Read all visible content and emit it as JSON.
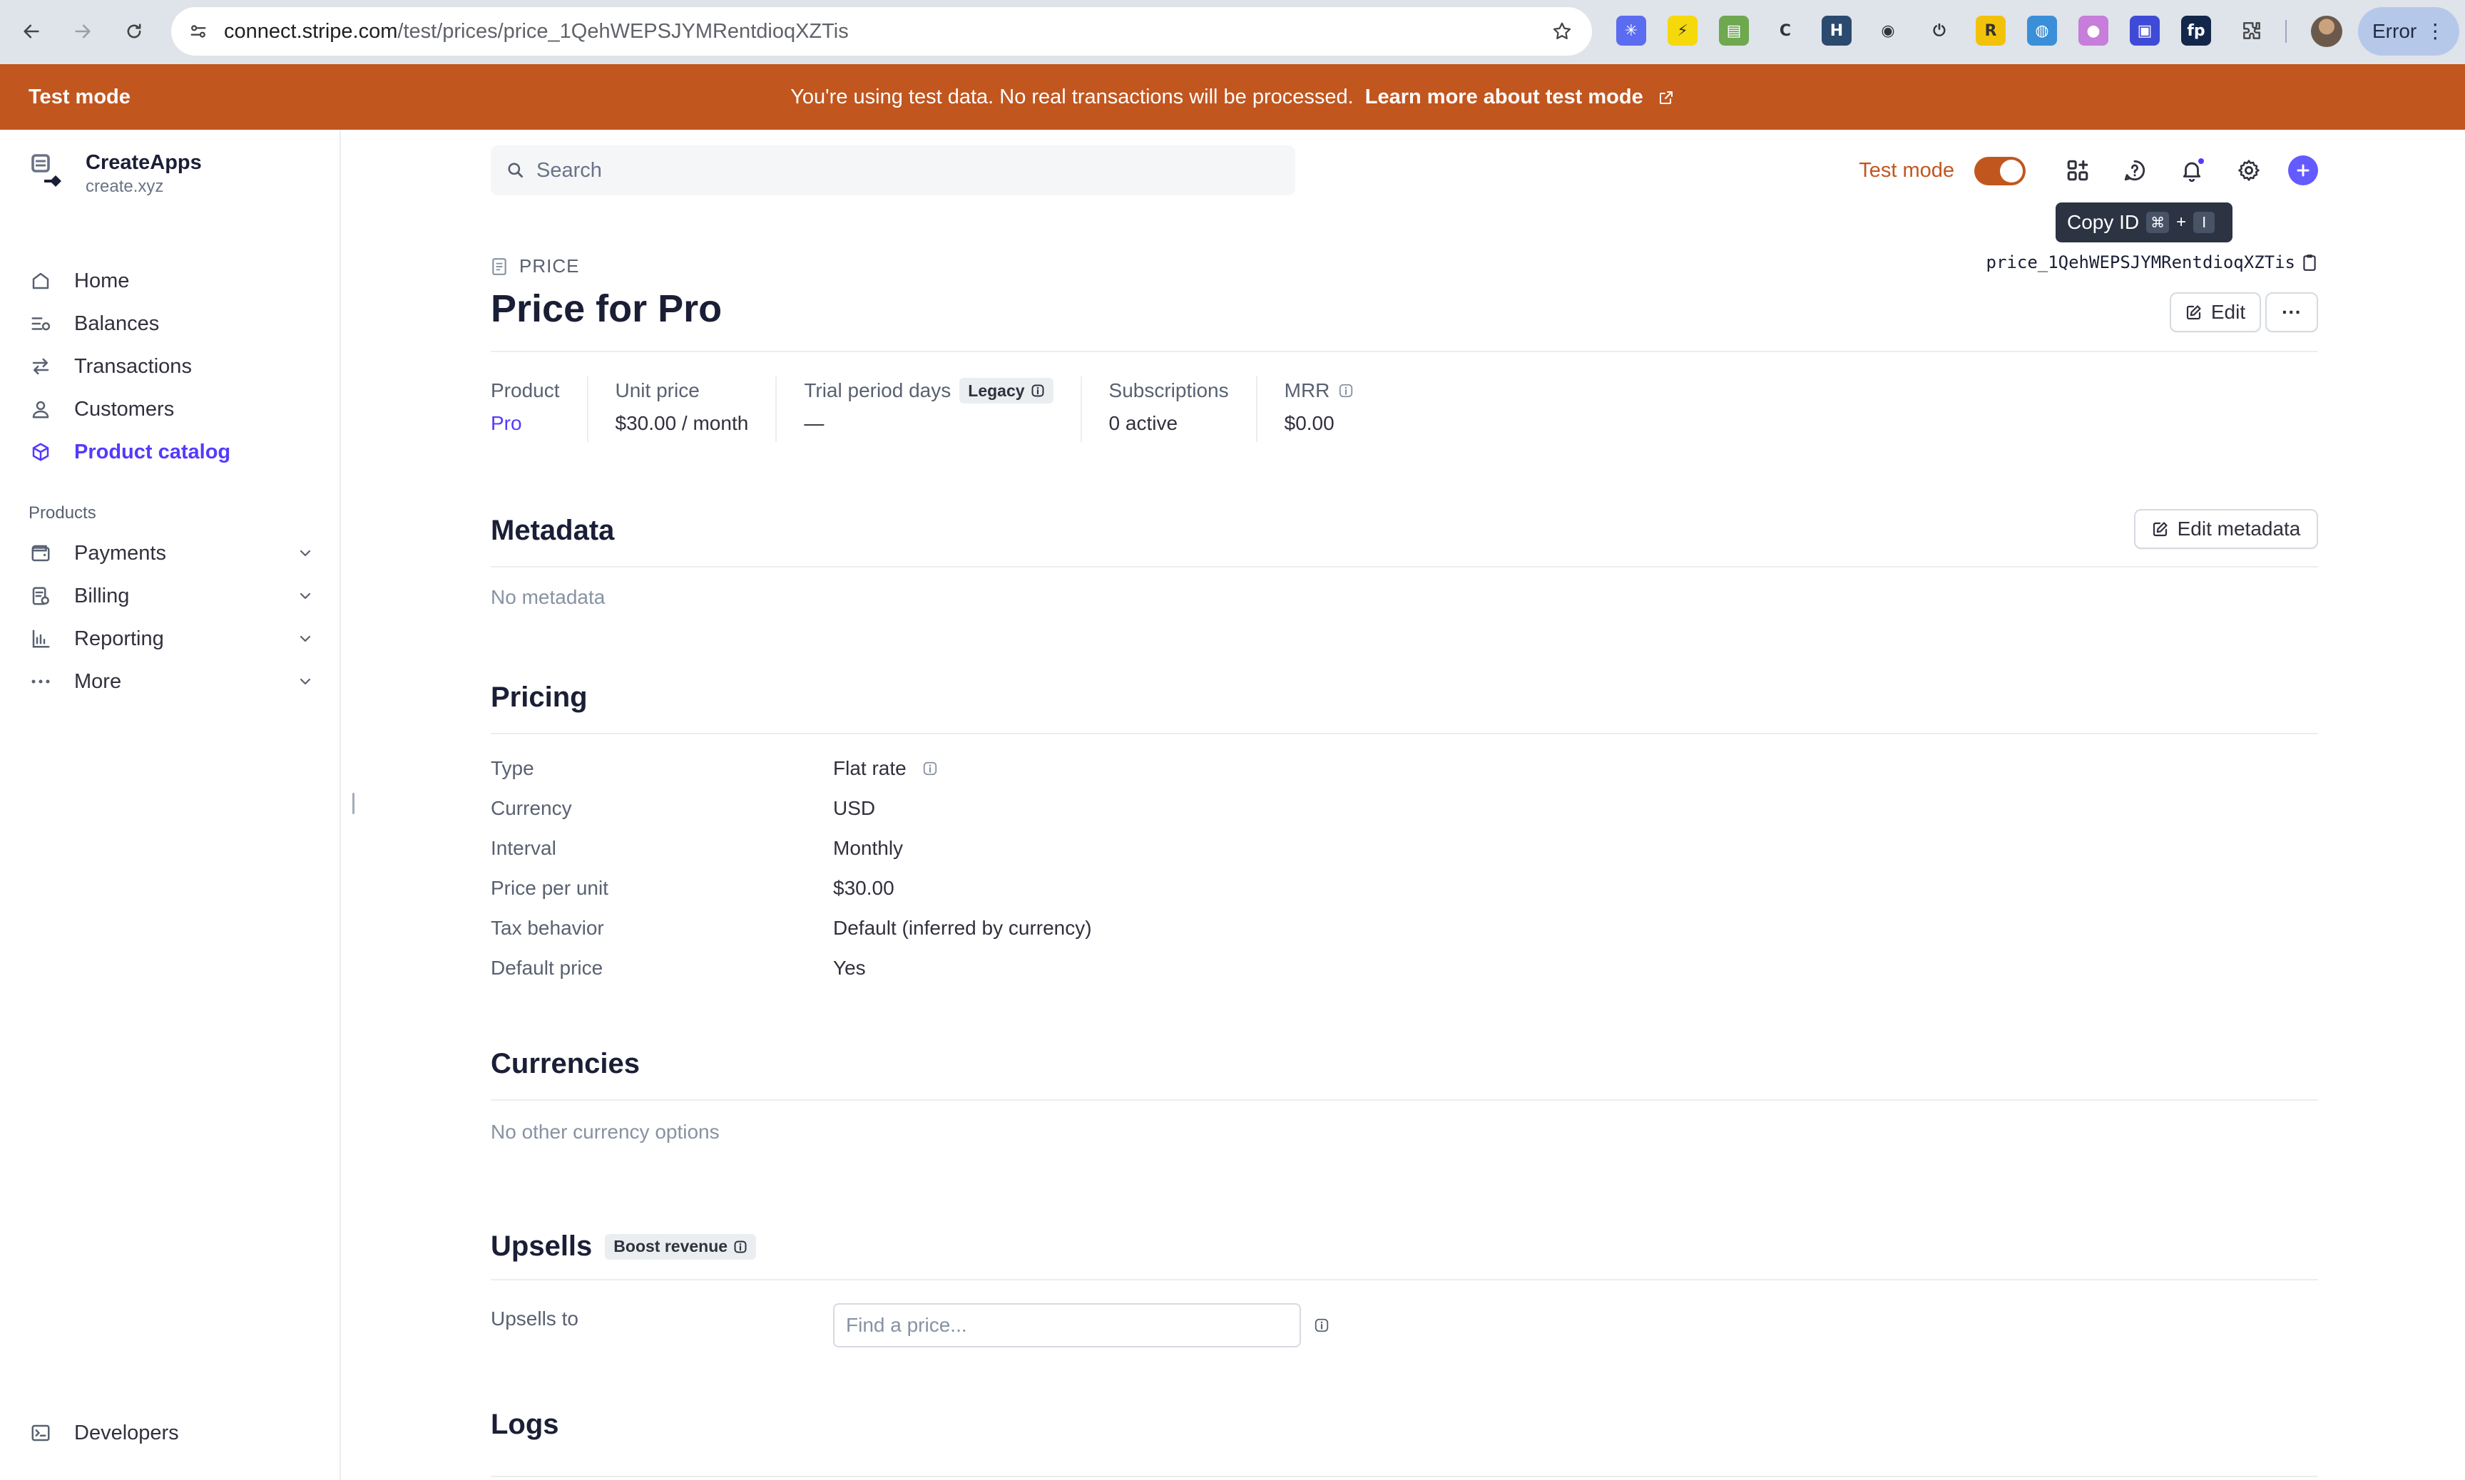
{
  "browser": {
    "url_host": "connect.stripe.com",
    "url_path": "/test/prices/price_1QehWEPSJYMRentdioqXZTis",
    "profile_status": "Error",
    "extensions": [
      {
        "name": "perplexity-extension-icon",
        "color": "#5b6cf0",
        "glyph": "✳"
      },
      {
        "name": "lightning-extension-icon",
        "color": "#f5d90a",
        "glyph": "⚡"
      },
      {
        "name": "tab-extension-icon",
        "color": "#6ea84f",
        "glyph": "▤"
      },
      {
        "name": "c-extension-icon",
        "color": "#ffffff",
        "glyph": "C"
      },
      {
        "name": "h-extension-icon",
        "color": "#2b4a6e",
        "glyph": "H"
      },
      {
        "name": "camera-extension-icon",
        "color": "#ffffff",
        "glyph": "◉"
      },
      {
        "name": "power-extension-icon",
        "color": "#ffffff",
        "glyph": "⏻"
      },
      {
        "name": "r-extension-icon",
        "color": "#f2c20b",
        "glyph": "R"
      },
      {
        "name": "globe-extension-icon",
        "color": "#3a8fd8",
        "glyph": "◍"
      },
      {
        "name": "orb-extension-icon",
        "color": "#c77dda",
        "glyph": "●"
      },
      {
        "name": "square-extension-icon",
        "color": "#3f4bd6",
        "glyph": "▣"
      },
      {
        "name": "fp-extension-icon",
        "color": "#13274b",
        "glyph": "fp"
      }
    ]
  },
  "banner": {
    "label": "Test mode",
    "message": "You're using test data. No real transactions will be processed.",
    "link": "Learn more about test mode"
  },
  "account": {
    "name": "CreateApps",
    "domain": "create.xyz"
  },
  "sidebar": {
    "items": [
      {
        "label": "Home"
      },
      {
        "label": "Balances"
      },
      {
        "label": "Transactions"
      },
      {
        "label": "Customers"
      },
      {
        "label": "Product catalog"
      }
    ],
    "products_heading": "Products",
    "product_items": [
      {
        "label": "Payments"
      },
      {
        "label": "Billing"
      },
      {
        "label": "Reporting"
      },
      {
        "label": "More"
      }
    ],
    "developers": "Developers"
  },
  "topbar": {
    "search_placeholder": "Search",
    "test_mode_label": "Test mode",
    "test_mode_on": true
  },
  "tooltip": {
    "text": "Copy ID",
    "key1": "⌘",
    "plus": "+",
    "key2": "I"
  },
  "header": {
    "object_label": "PRICE",
    "price_id": "price_1QehWEPSJYMRentdioqXZTis",
    "title": "Price for Pro",
    "edit_label": "Edit",
    "more_label": "···"
  },
  "summary": {
    "product_label": "Product",
    "product_value": "Pro",
    "unit_price_label": "Unit price",
    "unit_price_value": "$30.00 / month",
    "trial_label": "Trial period days",
    "trial_badge": "Legacy",
    "trial_value": "—",
    "subscriptions_label": "Subscriptions",
    "subscriptions_value": "0 active",
    "mrr_label": "MRR",
    "mrr_value": "$0.00"
  },
  "metadata": {
    "title": "Metadata",
    "edit_label": "Edit metadata",
    "empty": "No metadata"
  },
  "pricing": {
    "title": "Pricing",
    "rows": [
      {
        "key": "Type",
        "value": "Flat rate"
      },
      {
        "key": "Currency",
        "value": "USD"
      },
      {
        "key": "Interval",
        "value": "Monthly"
      },
      {
        "key": "Price per unit",
        "value": "$30.00"
      },
      {
        "key": "Tax behavior",
        "value": "Default (inferred by currency)"
      },
      {
        "key": "Default price",
        "value": "Yes"
      }
    ]
  },
  "currencies": {
    "title": "Currencies",
    "empty": "No other currency options"
  },
  "upsells": {
    "title": "Upsells",
    "badge": "Boost revenue",
    "row_label": "Upsells to",
    "placeholder": "Find a price..."
  },
  "logs": {
    "title": "Logs"
  },
  "colors": {
    "accent": "#533afd",
    "test_mode": "#c1561f"
  }
}
